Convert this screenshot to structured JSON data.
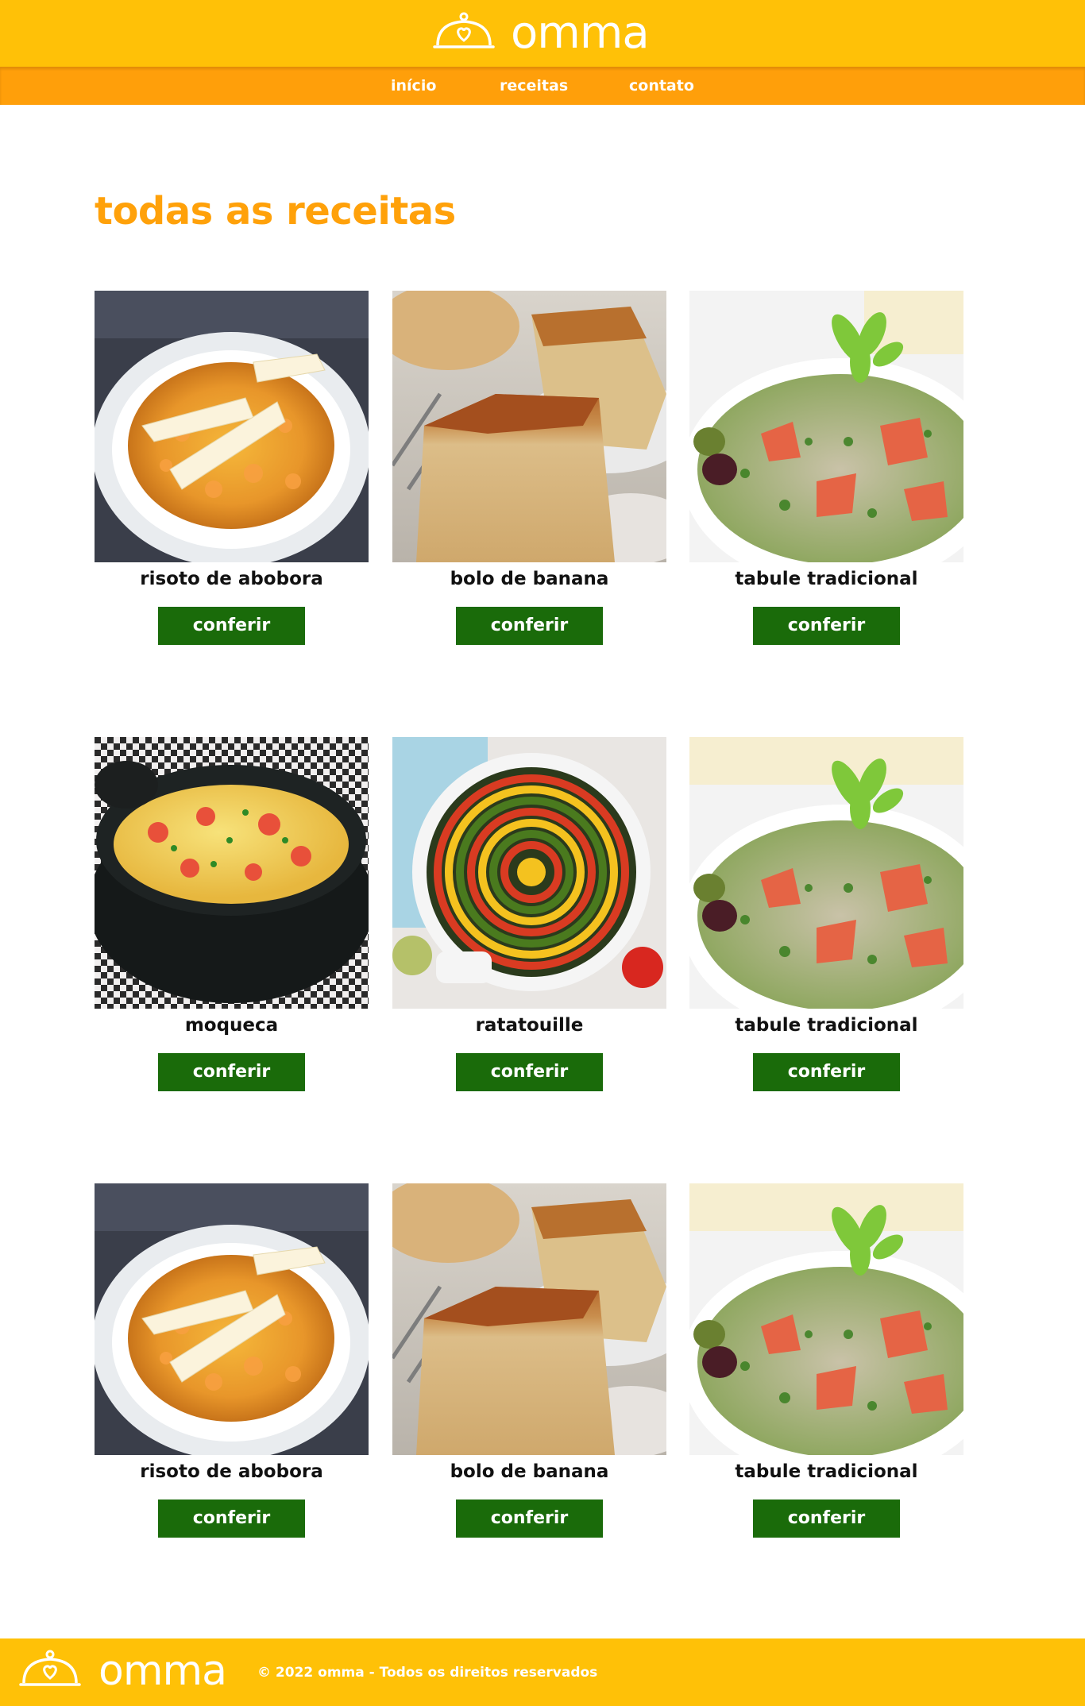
{
  "brand": {
    "name": "omma",
    "logo_icon": "cloche-heart-icon",
    "primary_color": "#ffc107",
    "nav_color": "#ff9f0a",
    "accent_color": "#ffa10a",
    "button_color": "#1a6b0a"
  },
  "nav": {
    "items": [
      {
        "label": "início"
      },
      {
        "label": "receitas"
      },
      {
        "label": "contato"
      }
    ]
  },
  "main": {
    "title": "todas as receitas",
    "recipes": [
      {
        "name": "risoto de abobora",
        "button": "conferir",
        "image": "risotto-photo"
      },
      {
        "name": "bolo de banana",
        "button": "conferir",
        "image": "banana-cake-photo"
      },
      {
        "name": "tabule tradicional",
        "button": "conferir",
        "image": "tabbouleh-photo"
      },
      {
        "name": "moqueca",
        "button": "conferir",
        "image": "moqueca-photo"
      },
      {
        "name": "ratatouille",
        "button": "conferir",
        "image": "ratatouille-photo"
      },
      {
        "name": "tabule tradicional",
        "button": "conferir",
        "image": "tabbouleh-photo"
      },
      {
        "name": "risoto de abobora",
        "button": "conferir",
        "image": "risotto-photo"
      },
      {
        "name": "bolo de banana",
        "button": "conferir",
        "image": "banana-cake-photo"
      },
      {
        "name": "tabule tradicional",
        "button": "conferir",
        "image": "tabbouleh-photo"
      }
    ]
  },
  "footer": {
    "brand": "omma",
    "copyright": "© 2022 omma - Todos os direitos reservados"
  }
}
